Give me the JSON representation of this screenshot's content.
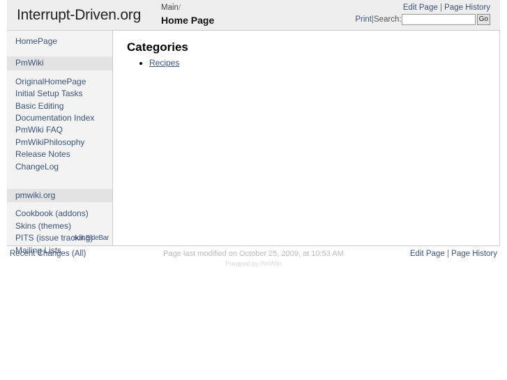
{
  "header": {
    "site_title": "Interrupt-Driven.org",
    "breadcrumb_group": "Main",
    "breadcrumb_separator": "/",
    "page_title": "Home Page",
    "actions": {
      "edit_page": "Edit Page",
      "separator": "|",
      "page_history": "Page History",
      "print": "Print",
      "search_label": "Search:",
      "search_value": "",
      "search_placeholder": "",
      "go_button": "Go"
    }
  },
  "sidebar": {
    "home_link": "HomePage",
    "sections": [
      {
        "heading": "PmWiki",
        "items": [
          "OriginalHomePage",
          "Initial Setup Tasks",
          "Basic Editing",
          "Documentation Index",
          "PmWiki FAQ",
          "PmWikiPhilosophy",
          "Release Notes",
          "ChangeLog"
        ]
      },
      {
        "heading": "pmwiki.org",
        "items": [
          "Cookbook (addons)",
          "Skins (themes)",
          "PITS (issue tracking)",
          "Mailing Lists"
        ]
      }
    ],
    "edit_sidebar": "edit SideBar"
  },
  "main": {
    "heading": "Categories",
    "links": [
      "Recipes"
    ]
  },
  "footer": {
    "recent_changes": "Recent Changes (All)",
    "last_modified": "Page last modified on October 25, 2009, at 10:53 AM",
    "powered_by": "Powered by PmWiki",
    "edit_page": "Edit Page",
    "separator": "|",
    "page_history": "Page History"
  },
  "colors": {
    "link": "#3b5378",
    "header_bg": "#eeeeee",
    "sidebar_bg": "#f3f3f3",
    "sidebar_heading_bg": "#e3e3e3",
    "border": "#cccccc"
  }
}
